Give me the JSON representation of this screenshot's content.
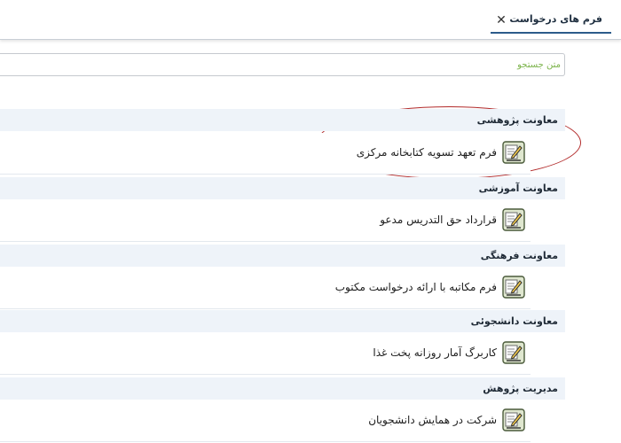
{
  "tabs": [
    {
      "label": "فرم های درخواست",
      "close_glyph": "✕",
      "active": true
    }
  ],
  "search": {
    "placeholder": "متن جستجو",
    "value": ""
  },
  "sections": [
    {
      "title": "معاونت پژوهشی",
      "items": [
        {
          "label": "فرم تعهد تسویه کتابخانه مرکزی",
          "icon": "form-edit-icon"
        }
      ]
    },
    {
      "title": "معاونت آموزشی",
      "items": [
        {
          "label": "قرارداد حق التدریس مدعو",
          "icon": "form-edit-icon"
        }
      ]
    },
    {
      "title": "معاونت فرهنگی",
      "items": [
        {
          "label": "فرم مکاتبه با ارائه درخواست مکتوب",
          "icon": "form-edit-icon"
        }
      ]
    },
    {
      "title": "معاونت دانشجوئی",
      "items": [
        {
          "label": "کاربرگ آمار روزانه پخت غذا",
          "icon": "form-edit-icon"
        }
      ]
    },
    {
      "title": "مدیریت پژوهش",
      "items": [
        {
          "label": "شرکت در همایش دانشجویان",
          "icon": "form-edit-icon"
        }
      ]
    }
  ],
  "colors": {
    "accent": "#2b5b8a",
    "section_bg": "#eef3f9",
    "placeholder": "#7bb34a",
    "highlight": "#b22a2a"
  }
}
